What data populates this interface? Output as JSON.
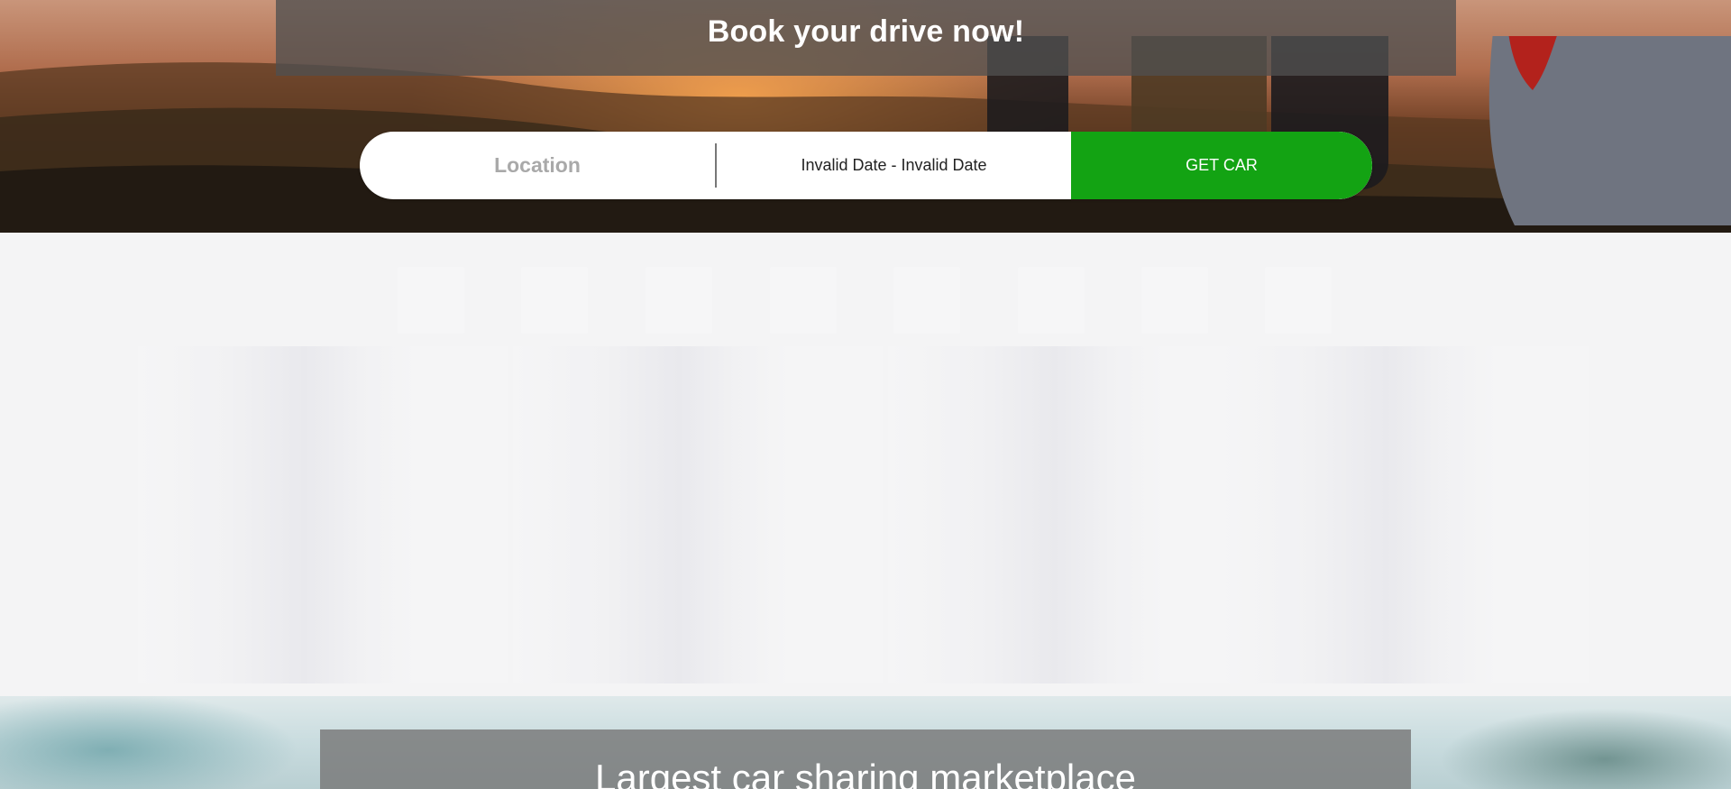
{
  "hero": {
    "title": "Book your drive now!",
    "background": "sunset-hills-family-car-photo"
  },
  "search": {
    "location_placeholder": "Location",
    "date_range": "Invalid Date - Invalid Date",
    "submit_label": "GET CAR",
    "submit_color": "#13a313"
  },
  "loading": {
    "chip_count": 8,
    "card_count": 4
  },
  "banner": {
    "title": "Largest car sharing marketplace"
  }
}
